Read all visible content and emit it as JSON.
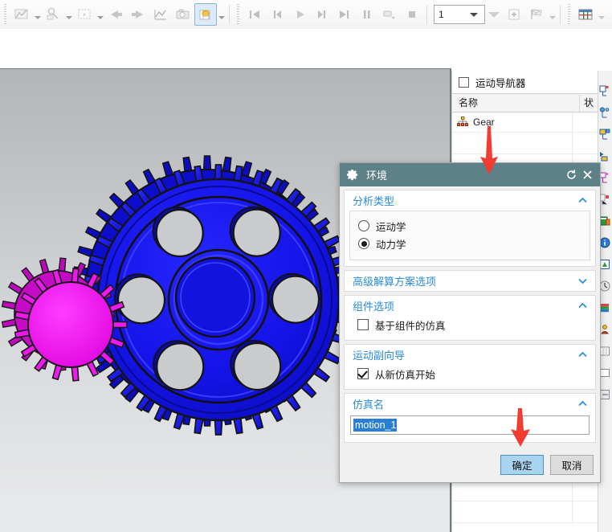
{
  "toolbar": {
    "items": [
      {
        "name": "motion-animation-icon",
        "caret": true
      },
      {
        "name": "spreadsheet-run-icon",
        "caret": true
      },
      {
        "name": "articulation-icon",
        "caret": true
      },
      {
        "name": "previous-step-icon",
        "caret": false
      },
      {
        "name": "next-step-icon",
        "caret": false
      },
      {
        "name": "graphing-icon",
        "caret": false
      },
      {
        "name": "camera-capture-icon",
        "caret": false
      },
      {
        "name": "package-export-icon",
        "caret": true,
        "selected": true
      }
    ],
    "playback": [
      {
        "name": "go-to-start-icon"
      },
      {
        "name": "step-back-icon"
      },
      {
        "name": "play-icon"
      },
      {
        "name": "step-forward-icon"
      },
      {
        "name": "go-to-end-icon"
      },
      {
        "name": "pause-icon"
      },
      {
        "name": "export-movie-icon"
      },
      {
        "name": "stop-icon"
      }
    ],
    "step_value": "1",
    "trailing": [
      {
        "name": "filter-dropdown-icon"
      },
      {
        "name": "add-marker-icon"
      },
      {
        "name": "finish-flag-icon",
        "caret": true
      },
      {
        "name": "spreadsheet-icon",
        "caret": true
      }
    ]
  },
  "navigator": {
    "title": "运动导航器",
    "columns": [
      "名称",
      "状"
    ],
    "rows": [
      {
        "icon": "assembly-node-icon",
        "label": "Gear"
      }
    ],
    "empty_rows": 18
  },
  "resource_bar": {
    "icons": [
      "history-icon",
      "assembly-navigator-icon",
      "constraint-navigator-icon",
      "part-navigator-icon",
      "reuse-library-icon",
      "html-help-icon",
      "web-browser-icon",
      "internet-explorer-icon",
      "system-materials-icon",
      "process-studio-icon",
      "roles-icon",
      "color-palette-icon",
      "view-manager-icon",
      "layers-icon",
      "more-icon"
    ]
  },
  "dialog": {
    "title": "环境",
    "title_icon": "gear-icon",
    "reset_icon": "reset-icon",
    "close_icon": "close-icon",
    "sections": [
      {
        "key": "analysis_type",
        "label": "分析类型",
        "expanded": true,
        "chevron": "chevron-up-icon",
        "radios": [
          {
            "label": "运动学",
            "checked": false
          },
          {
            "label": "动力学",
            "checked": true
          }
        ]
      },
      {
        "key": "advanced_solver",
        "label": "高级解算方案选项",
        "expanded": false,
        "chevron": "chevron-down-icon"
      },
      {
        "key": "component_options",
        "label": "组件选项",
        "expanded": true,
        "chevron": "chevron-up-icon",
        "checkbox": {
          "label": "基于组件的仿真",
          "checked": false
        }
      },
      {
        "key": "joint_wizard",
        "label": "运动副向导",
        "expanded": true,
        "chevron": "chevron-up-icon",
        "checkbox": {
          "label": "从新仿真开始",
          "checked": true
        }
      },
      {
        "key": "simulation_name",
        "label": "仿真名",
        "expanded": true,
        "chevron": "chevron-up-icon",
        "input": {
          "value": "motion_1",
          "selected": true
        }
      }
    ],
    "buttons": {
      "ok": "确定",
      "cancel": "取消"
    }
  },
  "viewport": {
    "model_name": "gear-pair-3d-model",
    "parts": [
      {
        "name": "driven-gear",
        "color": "#1414e6",
        "teeth": 40,
        "holes": 6
      },
      {
        "name": "drive-pinion",
        "color": "#e61ae6",
        "teeth": 17
      }
    ],
    "background_top": "#b3b5b8",
    "background_bottom": "#e6e7e8"
  },
  "annotations": {
    "arrow_color": "#f23c32",
    "arrows": [
      {
        "name": "arrow-pointing-to-dialog-title"
      },
      {
        "name": "arrow-pointing-to-ok-button"
      }
    ]
  }
}
